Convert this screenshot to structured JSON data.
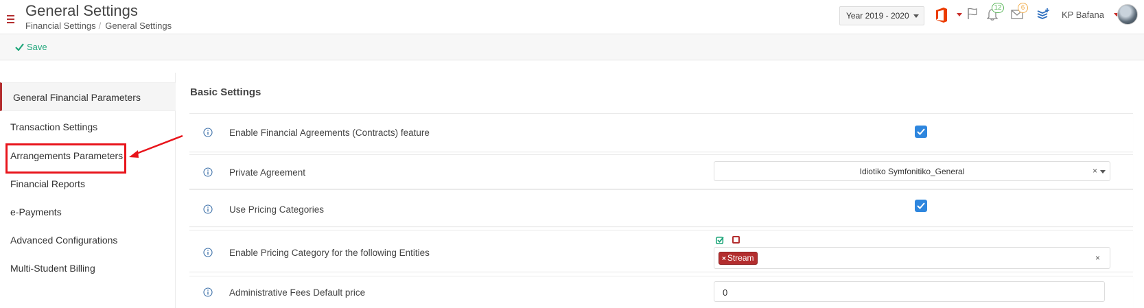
{
  "header": {
    "title": "General Settings",
    "breadcrumb": [
      "Financial Settings",
      "General Settings"
    ],
    "breadcrumb_separator": "/",
    "year_select": "Year 2019 - 2020",
    "notifications_count": "12",
    "messages_count": "6",
    "user_name": "KP Bafana"
  },
  "toolbar": {
    "save_label": "Save"
  },
  "sidebar": {
    "items": [
      {
        "label": "General Financial Parameters",
        "active": true
      },
      {
        "label": "Transaction Settings"
      },
      {
        "label": "Arrangements Parameters",
        "highlighted": true
      },
      {
        "label": "Financial Reports"
      },
      {
        "label": "e-Payments"
      },
      {
        "label": "Advanced Configurations"
      },
      {
        "label": "Multi-Student Billing"
      }
    ]
  },
  "main": {
    "section_title": "Basic Settings",
    "rows": [
      {
        "label": "Enable Financial Agreements (Contracts) feature",
        "control": "checkbox",
        "checked": true
      },
      {
        "label": "Private Agreement",
        "control": "select",
        "value": "Idiotiko Symfonitiko_General",
        "clear": "×"
      },
      {
        "label": "Use Pricing Categories",
        "control": "checkbox",
        "checked": true
      },
      {
        "label": "Enable Pricing Category for the following Entities",
        "control": "tags",
        "tags": [
          "Stream"
        ],
        "tag_remove": "×",
        "clear": "×"
      },
      {
        "label": "Administrative Fees Default price",
        "control": "input",
        "value": "0"
      }
    ]
  },
  "colors": {
    "accent_red": "#b32d2e",
    "save_green": "#1fa67a",
    "checkbox_blue": "#2e86de",
    "annotation_red": "#e8141b"
  }
}
